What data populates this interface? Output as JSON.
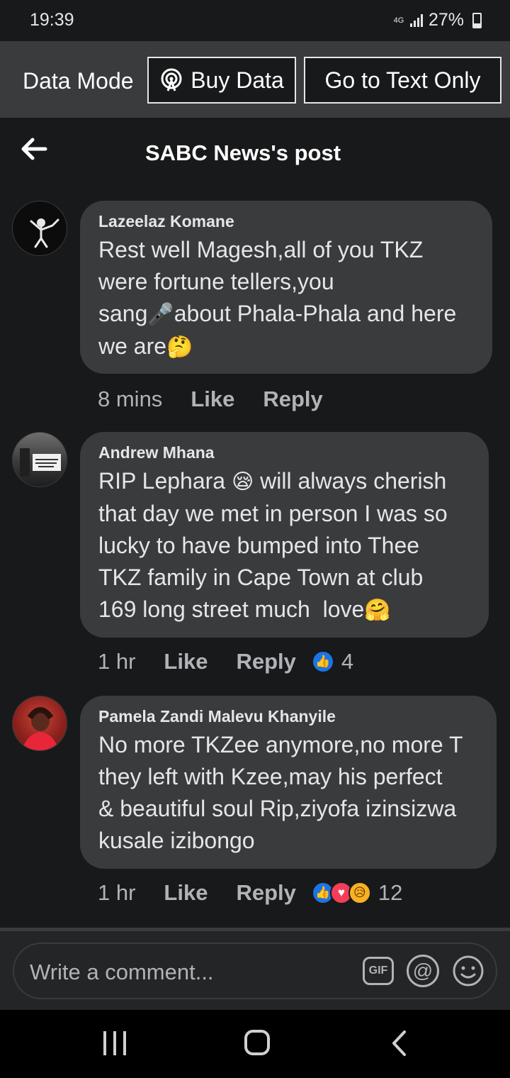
{
  "status_bar": {
    "time": "19:39",
    "network": "4G",
    "battery": "27%"
  },
  "data_bar": {
    "label": "Data Mode",
    "buy_data": "Buy Data",
    "text_only": "Go to Text Only"
  },
  "header": {
    "title": "SABC News's post"
  },
  "comments": [
    {
      "author": "Lazeelaz Komane",
      "text": "Rest well Magesh,all of you TKZ\nwere fortune tellers,you\nsang",
      "emoji_a": "🎤",
      "text_b": "about Phala-Phala and here\nwe are",
      "emoji_b": "🤔",
      "time": "8 mins",
      "like": "Like",
      "reply": "Reply"
    },
    {
      "author": "Andrew Mhana",
      "text": "RIP Lephara ",
      "emoji_a": "😪",
      "text_b": " will always cherish\nthat day we met in person I was so\nlucky to have bumped into Thee\nTKZ family in Cape Town at club\n169 long street much  love",
      "emoji_b": "🤗",
      "time": "1 hr",
      "like": "Like",
      "reply": "Reply",
      "reaction_count": "4"
    },
    {
      "author": "Pamela Zandi Malevu Khanyile",
      "text": "No more TKZee anymore,no more T\nthey left with Kzee,may his perfect\n& beautiful soul Rip,ziyofa izinsizwa\nkusale izibongo",
      "time": "1 hr",
      "like": "Like",
      "reply": "Reply",
      "reaction_count": "12"
    }
  ],
  "composer": {
    "placeholder": "Write a comment...",
    "gif": "GIF",
    "at": "@"
  }
}
